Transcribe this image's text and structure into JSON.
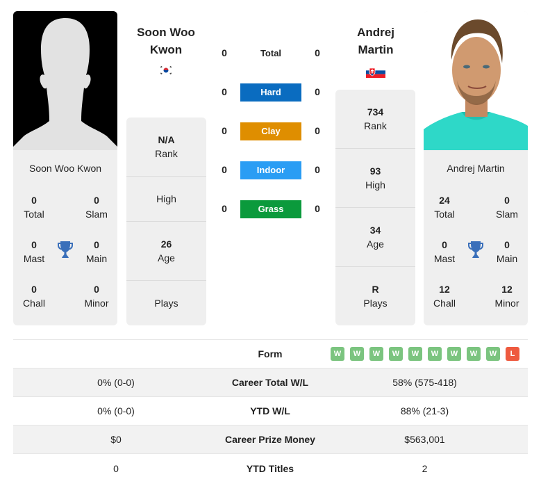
{
  "player_left": {
    "name": "Soon Woo Kwon",
    "name_line1": "Soon Woo",
    "name_line2": "Kwon",
    "flag": "south-korea-flag",
    "photo": "silhouette-placeholder",
    "titles": {
      "total": {
        "value": "0",
        "label": "Total"
      },
      "slam": {
        "value": "0",
        "label": "Slam"
      },
      "mast": {
        "value": "0",
        "label": "Mast"
      },
      "main": {
        "value": "0",
        "label": "Main"
      },
      "chall": {
        "value": "0",
        "label": "Chall"
      },
      "minor": {
        "value": "0",
        "label": "Minor"
      }
    },
    "stats": {
      "rank": {
        "value": "N/A",
        "label": "Rank"
      },
      "high": {
        "value": "",
        "label": "High"
      },
      "age": {
        "value": "26",
        "label": "Age"
      },
      "plays": {
        "value": "",
        "label": "Plays"
      }
    }
  },
  "player_right": {
    "name": "Andrej Martin",
    "name_line1": "Andrej",
    "name_line2": "Martin",
    "flag": "slovakia-flag",
    "photo": "player-headshot",
    "titles": {
      "total": {
        "value": "24",
        "label": "Total"
      },
      "slam": {
        "value": "0",
        "label": "Slam"
      },
      "mast": {
        "value": "0",
        "label": "Mast"
      },
      "main": {
        "value": "0",
        "label": "Main"
      },
      "chall": {
        "value": "12",
        "label": "Chall"
      },
      "minor": {
        "value": "12",
        "label": "Minor"
      }
    },
    "stats": {
      "rank": {
        "value": "734",
        "label": "Rank"
      },
      "high": {
        "value": "93",
        "label": "High"
      },
      "age": {
        "value": "34",
        "label": "Age"
      },
      "plays": {
        "value": "R",
        "label": "Plays"
      }
    }
  },
  "surfaces": [
    {
      "label": "Total",
      "left": "0",
      "right": "0",
      "color": null
    },
    {
      "label": "Hard",
      "left": "0",
      "right": "0",
      "color": "#0a6cc0"
    },
    {
      "label": "Clay",
      "left": "0",
      "right": "0",
      "color": "#df8e00"
    },
    {
      "label": "Indoor",
      "left": "0",
      "right": "0",
      "color": "#2a9df4"
    },
    {
      "label": "Grass",
      "left": "0",
      "right": "0",
      "color": "#0b9a3c"
    }
  ],
  "comparison": {
    "form_label": "Form",
    "form_right": [
      "W",
      "W",
      "W",
      "W",
      "W",
      "W",
      "W",
      "W",
      "W",
      "L"
    ],
    "form_colors": {
      "W": "#7bc47f",
      "L": "#ee5a3f"
    },
    "rows": [
      {
        "label": "Career Total W/L",
        "left": "0% (0-0)",
        "right": "58% (575-418)"
      },
      {
        "label": "YTD W/L",
        "left": "0% (0-0)",
        "right": "88% (21-3)"
      },
      {
        "label": "Career Prize Money",
        "left": "$0",
        "right": "$563,001"
      },
      {
        "label": "YTD Titles",
        "left": "0",
        "right": "2"
      }
    ]
  },
  "colors": {
    "card_bg": "#efefef",
    "trophy": "#3a6fba"
  }
}
